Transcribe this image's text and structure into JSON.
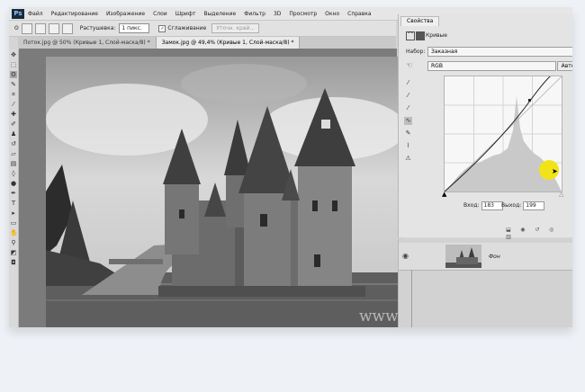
{
  "app": {
    "logo": "Ps"
  },
  "menu": [
    "Файл",
    "Редактирование",
    "Изображение",
    "Слои",
    "Шрифт",
    "Выделение",
    "Фильтр",
    "3D",
    "Просмотр",
    "Окно",
    "Справка"
  ],
  "options": {
    "feather_label": "Растушевка:",
    "feather_value": "1 пикс.",
    "smooth_label": "Сглаживание",
    "refine_button": "Уточн. край..."
  },
  "tabs": [
    {
      "label": "Поток.jpg @ 50% (Кривые 1, Слой-маска/8) *",
      "active": false
    },
    {
      "label": "Замок.jpg @ 49,4% (Кривые 1, Слой-маска/8) *",
      "active": true
    }
  ],
  "canvas": {
    "watermark": "www.photoshopsunduchok.ru"
  },
  "properties": {
    "tab": "Свойства",
    "title": "Кривые",
    "preset_label": "Набор:",
    "preset_value": "Заказная",
    "channel": "RGB",
    "auto": "Авто",
    "input_label": "Вход:",
    "input_value": "183",
    "output_label": "Выход:",
    "output_value": "199"
  },
  "layers": [
    {
      "name": "Фон"
    }
  ],
  "colors": {
    "curve": "#222222",
    "highlight_dot": "#f1e318"
  }
}
